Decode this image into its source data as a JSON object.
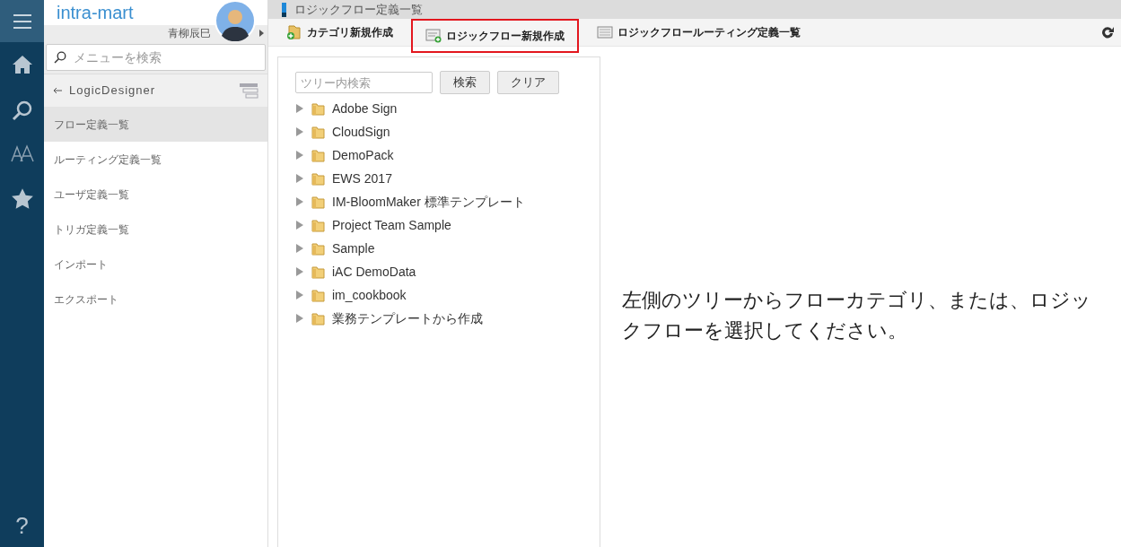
{
  "brand": "intra-mart",
  "user": {
    "name": "青柳辰巳"
  },
  "menu_search": {
    "placeholder": "メニューを検索"
  },
  "sidebar": {
    "back_label": "LogicDesigner",
    "items": [
      {
        "label": "フロー定義一覧",
        "selected": true
      },
      {
        "label": "ルーティング定義一覧",
        "selected": false
      },
      {
        "label": "ユーザ定義一覧",
        "selected": false
      },
      {
        "label": "トリガ定義一覧",
        "selected": false
      },
      {
        "label": "インポート",
        "selected": false
      },
      {
        "label": "エクスポート",
        "selected": false
      }
    ]
  },
  "page_title": "ロジックフロー定義一覧",
  "toolbar": [
    {
      "label": "カテゴリ新規作成",
      "kind": "category",
      "highlighted": false
    },
    {
      "label": "ロジックフロー新規作成",
      "kind": "flow",
      "highlighted": true
    },
    {
      "label": "ロジックフロールーティング定義一覧",
      "kind": "list",
      "highlighted": false
    }
  ],
  "tree_search": {
    "placeholder": "ツリー内検索",
    "buttons": [
      "検索",
      "クリア"
    ]
  },
  "tree": [
    {
      "label": "Adobe Sign",
      "expanded": false
    },
    {
      "label": "CloudSign",
      "expanded": false
    },
    {
      "label": "DemoPack",
      "expanded": false
    },
    {
      "label": "EWS 2017",
      "expanded": false
    },
    {
      "label": "IM-BloomMaker 標準テンプレート",
      "expanded": false
    },
    {
      "label": "Project Team Sample",
      "expanded": false
    },
    {
      "label": "Sample",
      "expanded": false
    },
    {
      "label": "iAC DemoData",
      "expanded": false
    },
    {
      "label": "im_cookbook",
      "expanded": false
    },
    {
      "label": "業務テンプレートから作成",
      "expanded": false
    }
  ],
  "message": "左側のツリーからフローカテゴリ、または、ロジックフローを選択してください。",
  "help": "?"
}
